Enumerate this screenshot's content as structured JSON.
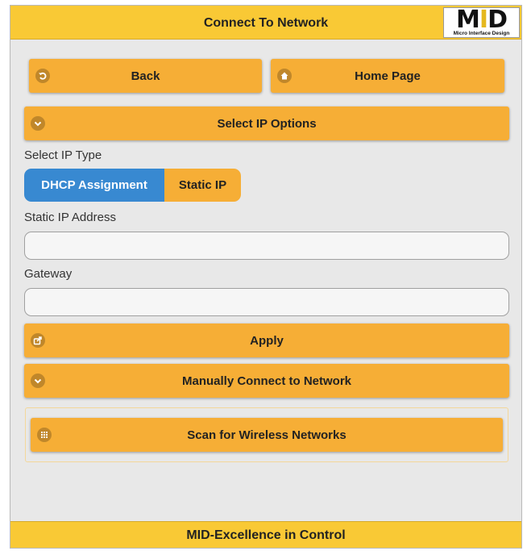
{
  "header": {
    "title": "Connect To Network"
  },
  "logo": {
    "mark": "MID",
    "subtitle": "Micro Interface Design"
  },
  "nav": {
    "back_label": "Back",
    "home_label": "Home Page"
  },
  "select_ip": {
    "header_label": "Select IP Options",
    "type_label": "Select IP Type",
    "options": [
      "DHCP Assignment",
      "Static IP"
    ],
    "selected": "DHCP Assignment",
    "static_ip_label": "Static IP Address",
    "static_ip_value": "",
    "gateway_label": "Gateway",
    "gateway_value": "",
    "apply_label": "Apply"
  },
  "manual": {
    "header_label": "Manually Connect to Network"
  },
  "scan": {
    "button_label": "Scan for Wireless Networks"
  },
  "footer": {
    "text": "MID-Excellence in Control"
  },
  "colors": {
    "accent": "#f6ae36",
    "header": "#f9c935",
    "selected": "#3889d1",
    "background": "#e8e8e8"
  },
  "icons": {
    "back": "back-arrow-icon",
    "home": "home-icon",
    "collapse": "chevron-down-icon",
    "apply": "export-icon",
    "scan": "grid-icon"
  }
}
